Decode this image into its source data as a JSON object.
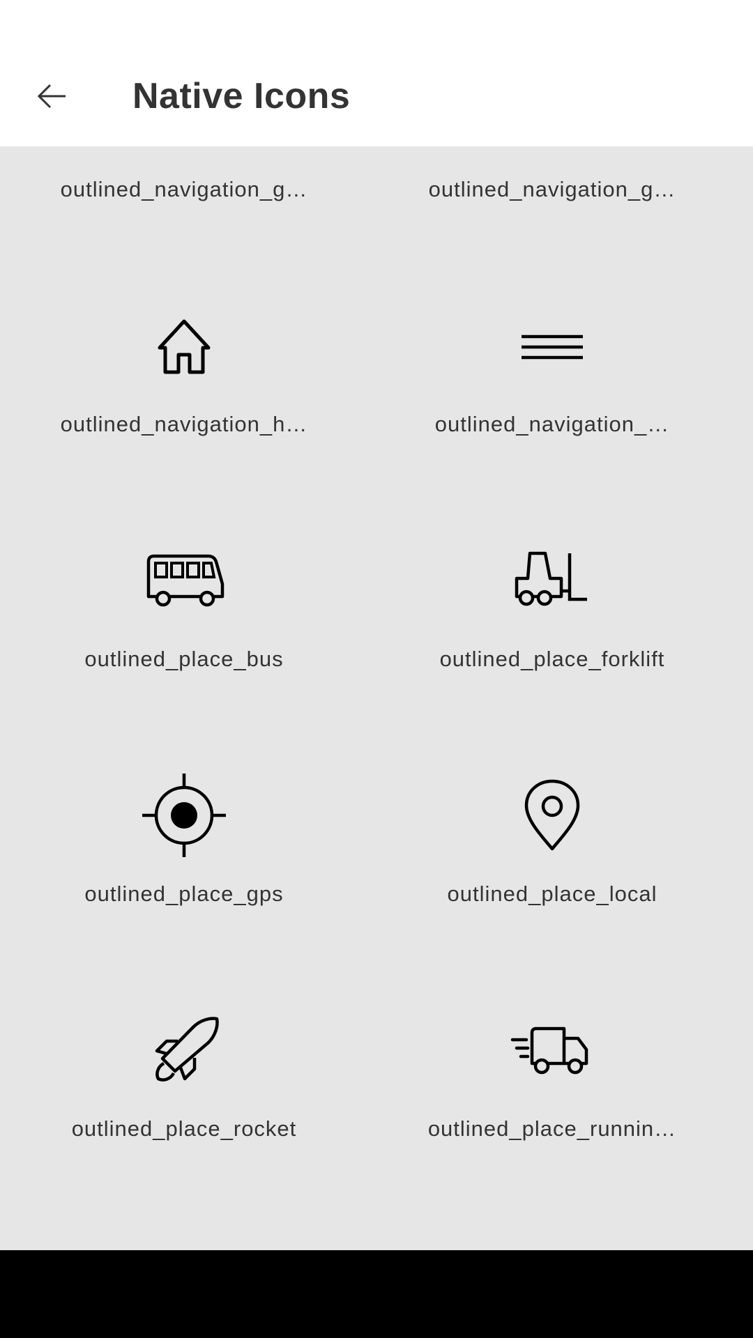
{
  "header": {
    "title": "Native Icons",
    "back_icon": "arrow-left-icon"
  },
  "icons": [
    {
      "label": "outlined_navigation_g…",
      "icon": "navigation-g-icon"
    },
    {
      "label": "outlined_navigation_g…",
      "icon": "navigation-g-icon"
    },
    {
      "label": "outlined_navigation_h…",
      "icon": "home-icon"
    },
    {
      "label": "outlined_navigation_…",
      "icon": "menu-lines-icon"
    },
    {
      "label": "outlined_place_bus",
      "icon": "bus-icon"
    },
    {
      "label": "outlined_place_forklift",
      "icon": "forklift-icon"
    },
    {
      "label": "outlined_place_gps",
      "icon": "gps-icon"
    },
    {
      "label": "outlined_place_local",
      "icon": "location-pin-icon"
    },
    {
      "label": "outlined_place_rocket",
      "icon": "rocket-icon"
    },
    {
      "label": "outlined_place_runnin…",
      "icon": "delivery-truck-icon"
    }
  ],
  "colors": {
    "topbar": "#ffffff",
    "background": "#e6e6e6",
    "text": "#333333",
    "navbar": "#000000"
  }
}
